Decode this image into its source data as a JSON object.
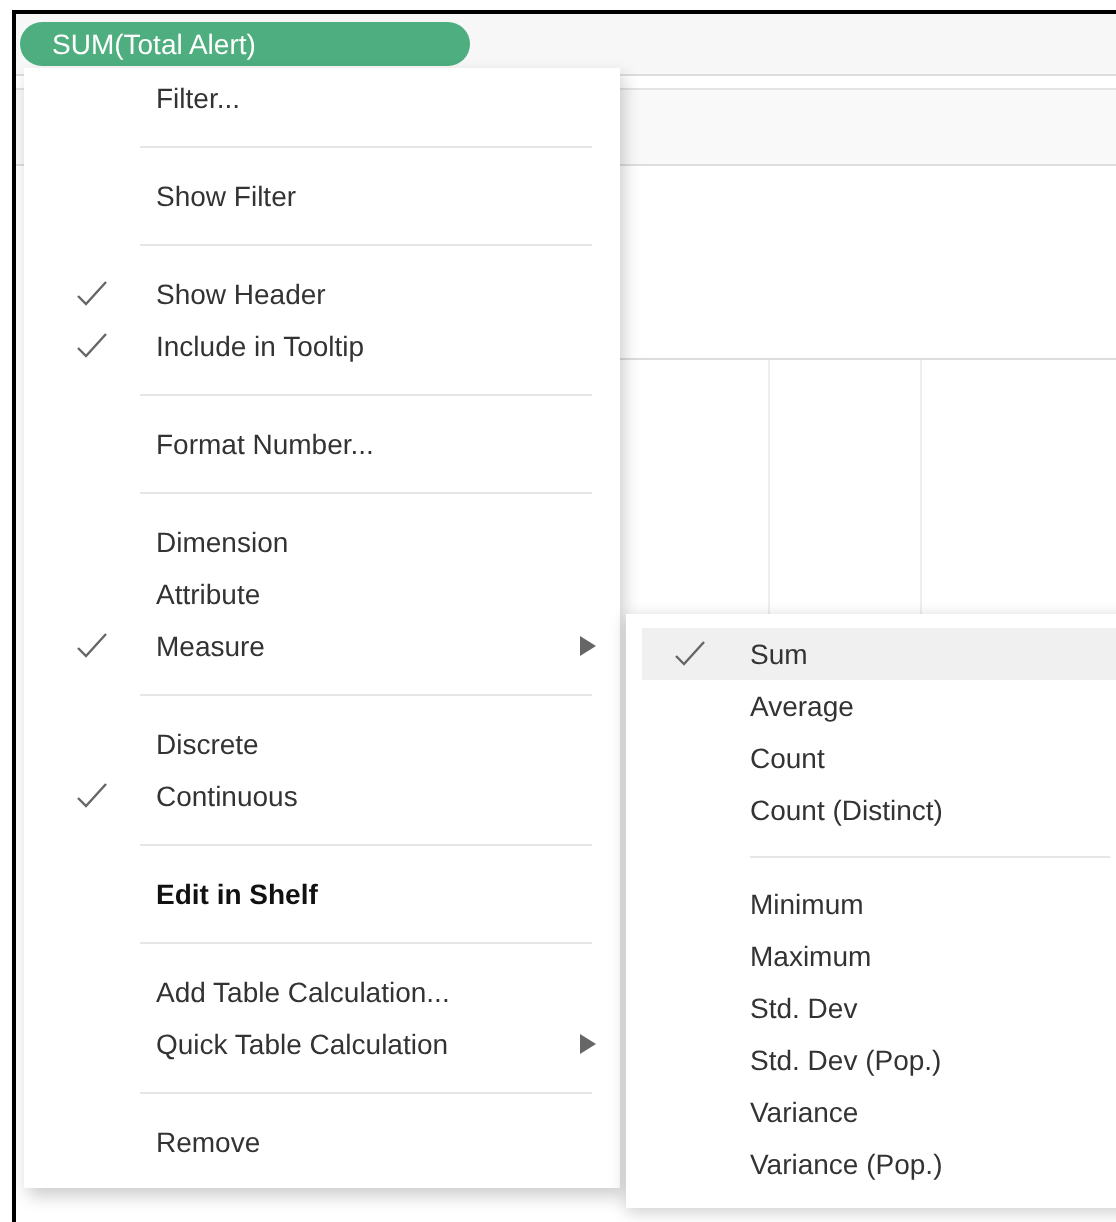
{
  "pill": {
    "label": "SUM(Total Alert)"
  },
  "menu": [
    {
      "kind": "item",
      "label": "Filter...",
      "checked": false,
      "bold": false,
      "submenu": false
    },
    {
      "kind": "separator"
    },
    {
      "kind": "item",
      "label": "Show Filter",
      "checked": false,
      "bold": false,
      "submenu": false
    },
    {
      "kind": "separator"
    },
    {
      "kind": "item",
      "label": "Show Header",
      "checked": true,
      "bold": false,
      "submenu": false
    },
    {
      "kind": "item",
      "label": "Include in Tooltip",
      "checked": true,
      "bold": false,
      "submenu": false
    },
    {
      "kind": "separator"
    },
    {
      "kind": "item",
      "label": "Format Number...",
      "checked": false,
      "bold": false,
      "submenu": false
    },
    {
      "kind": "separator"
    },
    {
      "kind": "item",
      "label": "Dimension",
      "checked": false,
      "bold": false,
      "submenu": false
    },
    {
      "kind": "item",
      "label": "Attribute",
      "checked": false,
      "bold": false,
      "submenu": false
    },
    {
      "kind": "item",
      "label": "Measure",
      "checked": true,
      "bold": false,
      "submenu": true
    },
    {
      "kind": "separator"
    },
    {
      "kind": "item",
      "label": "Discrete",
      "checked": false,
      "bold": false,
      "submenu": false
    },
    {
      "kind": "item",
      "label": "Continuous",
      "checked": true,
      "bold": false,
      "submenu": false
    },
    {
      "kind": "separator"
    },
    {
      "kind": "item",
      "label": "Edit in Shelf",
      "checked": false,
      "bold": true,
      "submenu": false
    },
    {
      "kind": "separator"
    },
    {
      "kind": "item",
      "label": "Add Table Calculation...",
      "checked": false,
      "bold": false,
      "submenu": false
    },
    {
      "kind": "item",
      "label": "Quick Table Calculation",
      "checked": false,
      "bold": false,
      "submenu": true
    },
    {
      "kind": "separator"
    },
    {
      "kind": "item",
      "label": "Remove",
      "checked": false,
      "bold": false,
      "submenu": false
    }
  ],
  "submenu": [
    {
      "kind": "item",
      "label": "Sum",
      "checked": true,
      "selected": true
    },
    {
      "kind": "item",
      "label": "Average",
      "checked": false,
      "selected": false
    },
    {
      "kind": "item",
      "label": "Count",
      "checked": false,
      "selected": false
    },
    {
      "kind": "item",
      "label": "Count (Distinct)",
      "checked": false,
      "selected": false
    },
    {
      "kind": "separator"
    },
    {
      "kind": "item",
      "label": "Minimum",
      "checked": false,
      "selected": false
    },
    {
      "kind": "item",
      "label": "Maximum",
      "checked": false,
      "selected": false
    },
    {
      "kind": "item",
      "label": "Std. Dev",
      "checked": false,
      "selected": false
    },
    {
      "kind": "item",
      "label": "Std. Dev (Pop.)",
      "checked": false,
      "selected": false
    },
    {
      "kind": "item",
      "label": "Variance",
      "checked": false,
      "selected": false
    },
    {
      "kind": "item",
      "label": "Variance (Pop.)",
      "checked": false,
      "selected": false
    }
  ]
}
